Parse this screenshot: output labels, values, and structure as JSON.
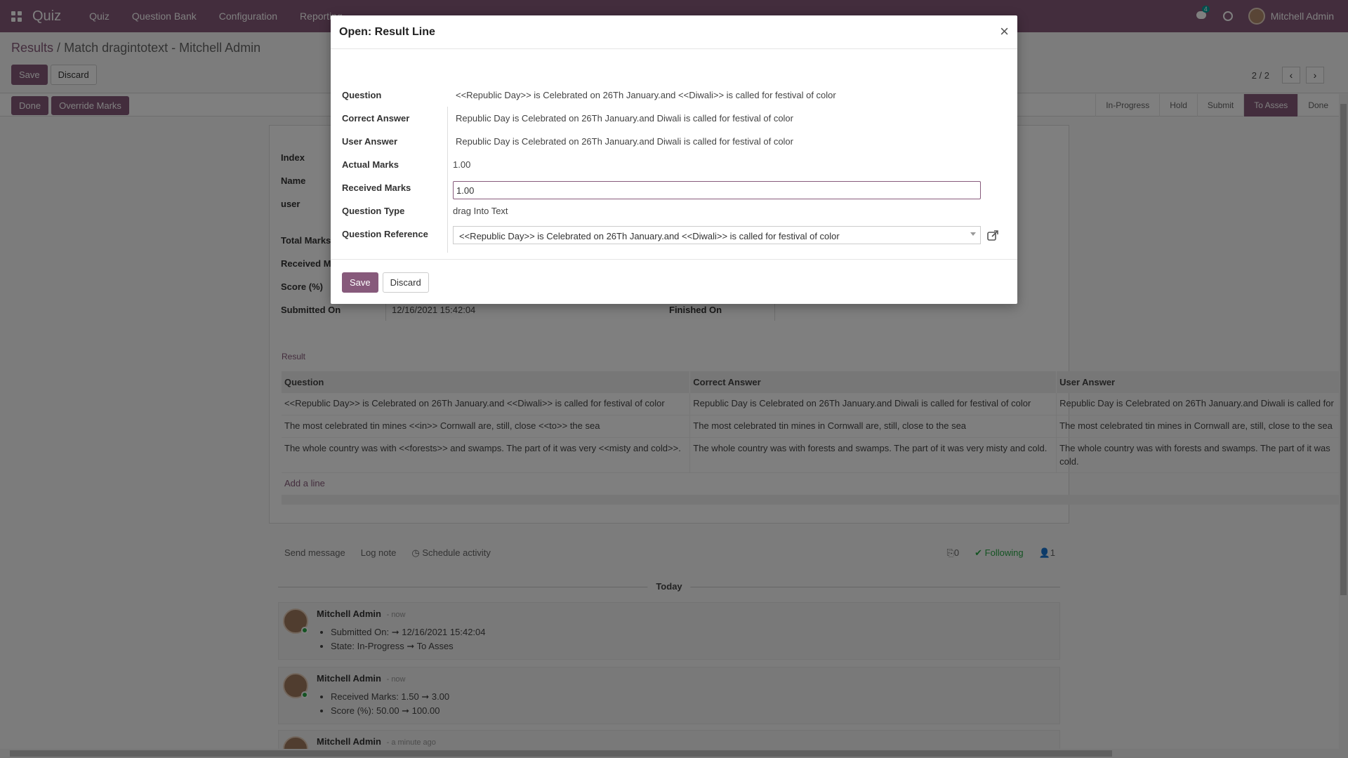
{
  "navbar": {
    "brand": "Quiz",
    "menus": [
      "Quiz",
      "Question Bank",
      "Configuration",
      "Reporting"
    ],
    "chat_count": "4",
    "user_name": "Mitchell Admin"
  },
  "breadcrumb": {
    "parent": "Results",
    "separator": "/",
    "current": "Match dragintotext - Mitchell Admin"
  },
  "control": {
    "save_label": "Save",
    "discard_label": "Discard",
    "pager_value": "2 / 2"
  },
  "statusbar": {
    "buttons": [
      "Done",
      "Override Marks"
    ],
    "stages": [
      "In-Progress",
      "Hold",
      "Submit",
      "To Asses",
      "Done"
    ],
    "active_stage": "To Asses"
  },
  "form": {
    "labels": [
      "Index",
      "Name",
      "user",
      "Total Marks",
      "Received Marks",
      "Score (%)",
      "Submitted On"
    ],
    "submitted_on": "12/16/2021 15:42:04",
    "finished_on_label": "Finished On",
    "result_tab": "Result",
    "table": {
      "headers": [
        "Question",
        "Correct Answer",
        "User Answer"
      ],
      "rows": [
        [
          " <<Republic Day>> is Celebrated on 26Th January.and <<Diwali>> is called for festival of color",
          " Republic Day is Celebrated on 26Th January.and Diwali is called for festival of color",
          " Republic Day is Celebrated on 26Th January.and Diwali is called for"
        ],
        [
          "The most celebrated tin mines <<in>> Cornwall are, still, close <<to>> the sea",
          "The most celebrated tin mines in Cornwall are, still, close to the sea",
          "The most celebrated tin mines in Cornwall are, still, close to the sea"
        ],
        [
          " The whole country was  with <<forests>> and swamps. The  part of it was very <<misty and cold>>.",
          " The whole country was  with forests and swamps. The  part of it was very misty and cold.",
          " The whole country was  with forests and swamps. The  part of it was cold."
        ]
      ],
      "add_line": "Add a line"
    }
  },
  "chatter": {
    "send_message": "Send message",
    "log_note": "Log note",
    "schedule_activity": "Schedule activity",
    "attachments": "0",
    "following": "Following",
    "followers": "1",
    "today": "Today",
    "messages": [
      {
        "author": "Mitchell Admin",
        "time": "- now",
        "items": [
          "Submitted On: ➞ 12/16/2021 15:42:04",
          "State: In-Progress ➞ To Asses"
        ]
      },
      {
        "author": "Mitchell Admin",
        "time": "- now",
        "items": [
          "Received Marks: 1.50 ➞ 3.00",
          "Score (%): 50.00 ➞ 100.00"
        ]
      },
      {
        "author": "Mitchell Admin",
        "time": "- a minute ago",
        "items": []
      }
    ]
  },
  "modal": {
    "title": "Open: Result Line",
    "close": "×",
    "fields": {
      "question_label": "Question",
      "question": "<<Republic Day>> is Celebrated on 26Th January.and <<Diwali>> is called for festival of color",
      "correct_label": "Correct Answer",
      "correct": "Republic Day is Celebrated on 26Th January.and Diwali is called for festival of color",
      "user_label": "User Answer",
      "user": "Republic Day is Celebrated on 26Th January.and Diwali is called for festival of color",
      "actual_label": "Actual Marks",
      "actual": "1.00",
      "received_label": "Received Marks",
      "received": "1.00",
      "type_label": "Question Type",
      "type": "drag Into Text",
      "reference_label": "Question Reference",
      "reference": "<<Republic Day>> is Celebrated on 26Th January.and <<Diwali>> is called for festival of color"
    },
    "save_label": "Save",
    "discard_label": "Discard"
  },
  "colors": {
    "brand": "#875a7b",
    "following": "#28a745"
  },
  "icons": [
    "apps-grid-icon",
    "chat-icon",
    "clock-icon",
    "chevron-left-icon",
    "chevron-right-icon",
    "paperclip-icon",
    "check-icon",
    "user-icon",
    "external-link-icon",
    "dropdown-caret-icon"
  ]
}
